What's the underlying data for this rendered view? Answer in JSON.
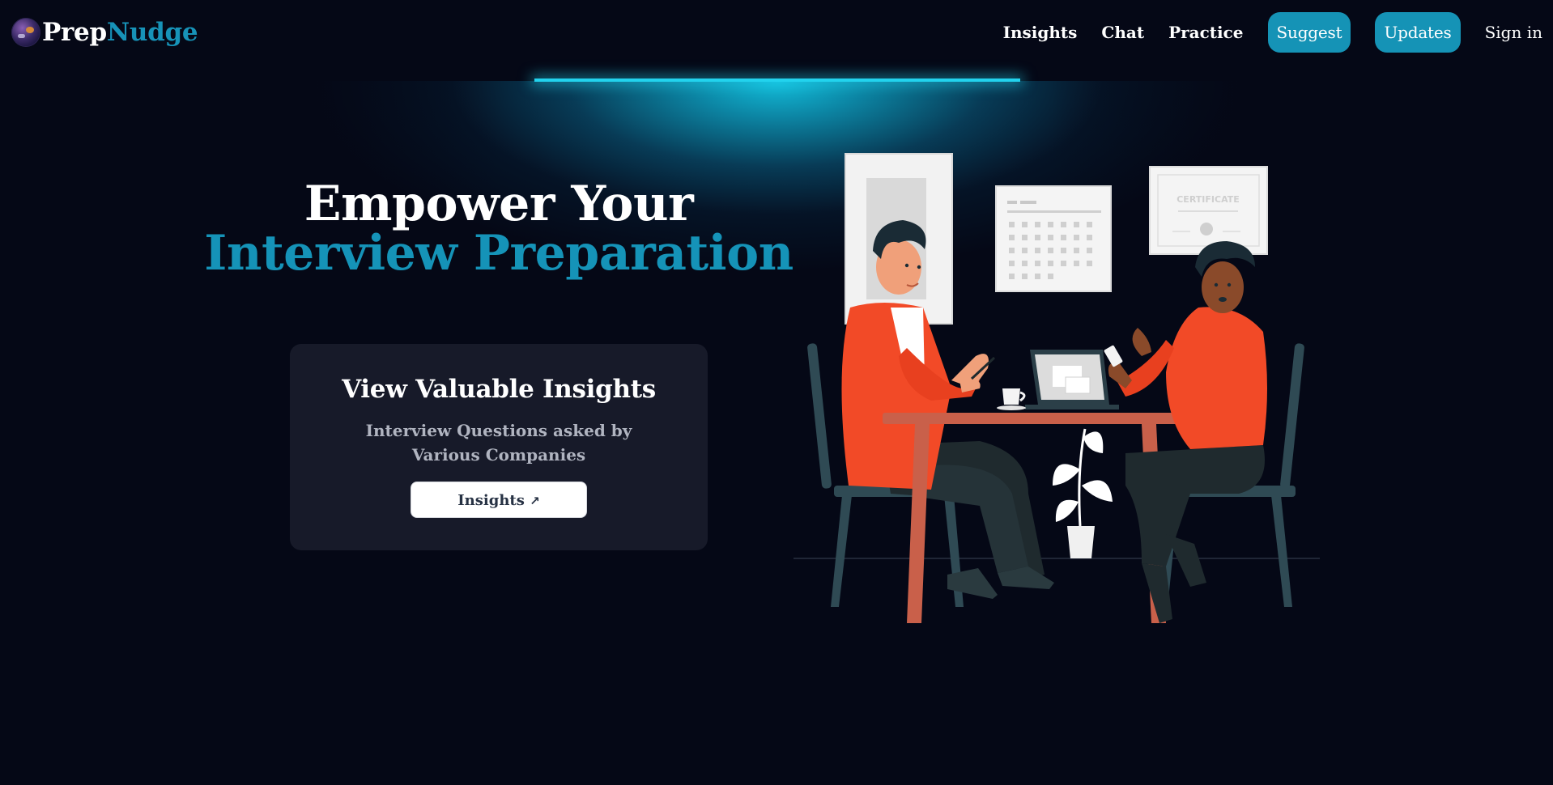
{
  "brand": {
    "name_part1": "Prep",
    "name_part2": "Nudge",
    "accent_color": "#1593b8"
  },
  "nav": {
    "links": [
      "Insights",
      "Chat",
      "Practice"
    ],
    "pills": [
      "Suggest",
      "Updates"
    ],
    "signin": "Sign in"
  },
  "hero": {
    "line1": "Empower Your",
    "line2": "Interview Preparation"
  },
  "card": {
    "title": "View Valuable Insights",
    "description": "Interview Questions asked by Various Companies",
    "button_label": "Insights",
    "button_icon": "external-arrow-icon"
  },
  "illustration": {
    "certificate_text": "CERTIFICATE"
  },
  "colors": {
    "background": "#050816",
    "card": "#171a29",
    "spotlight": "#22d3ee",
    "pill": "#1593b6"
  }
}
